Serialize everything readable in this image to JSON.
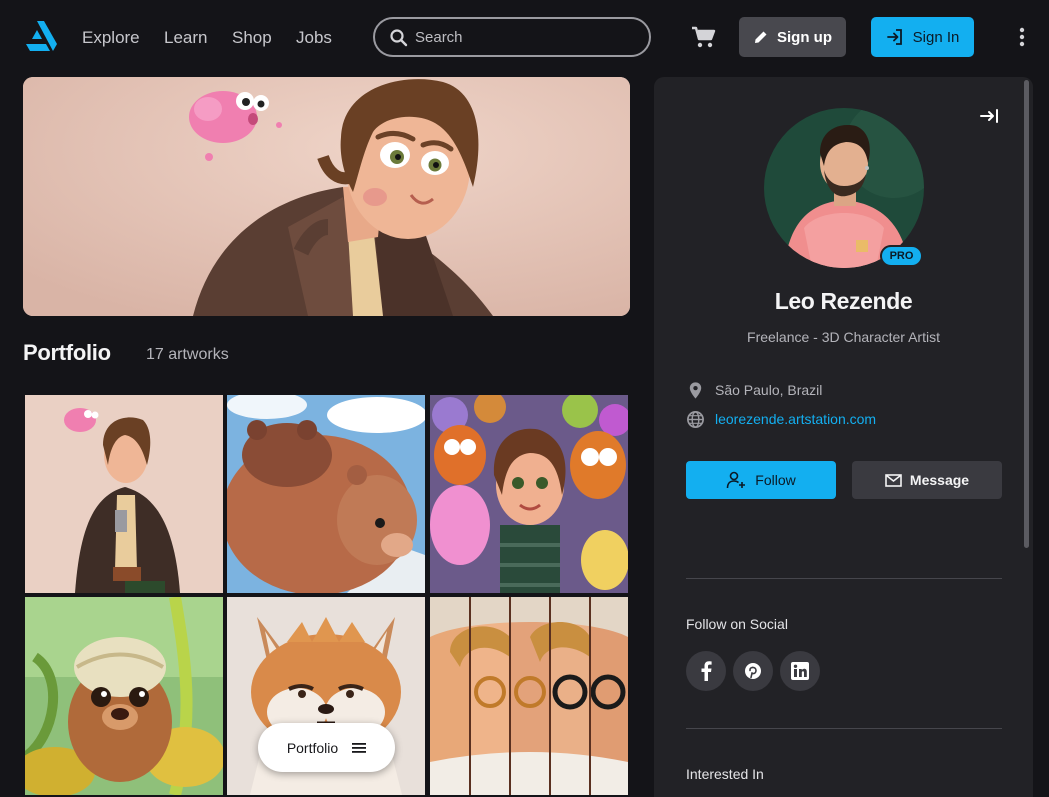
{
  "nav": {
    "links": [
      "Explore",
      "Learn",
      "Shop",
      "Jobs"
    ],
    "search_placeholder": "Search",
    "signup_label": "Sign up",
    "signin_label": "Sign In"
  },
  "portfolio": {
    "title": "Portfolio",
    "count": "17 artworks",
    "menu_pill_label": "Portfolio"
  },
  "profile": {
    "name": "Leo Rezende",
    "headline": "Freelance - 3D Character Artist",
    "pro_badge": "PRO",
    "location": "São Paulo, Brazil",
    "website": "leorezende.artstation.com",
    "follow_label": "Follow",
    "message_label": "Message",
    "follow_on_social": "Follow on Social",
    "social_networks": [
      "facebook",
      "pinterest",
      "linkedin"
    ],
    "interested_in": "Interested In"
  },
  "colors": {
    "accent": "#13aff0",
    "background": "#141418",
    "panel": "#222226"
  },
  "icons": [
    "artstation-logo-icon",
    "search-icon",
    "cart-icon",
    "pencil-icon",
    "sign-in-icon",
    "kebab-menu-icon",
    "collapse-panel-icon",
    "location-pin-icon",
    "globe-icon",
    "add-user-icon",
    "mail-icon",
    "facebook-icon",
    "pinterest-icon",
    "linkedin-icon",
    "hamburger-icon"
  ]
}
